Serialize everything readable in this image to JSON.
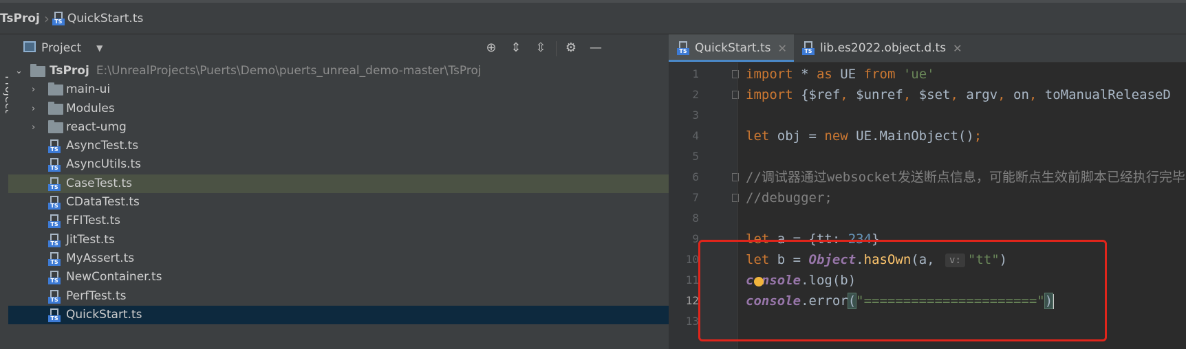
{
  "breadcrumb": {
    "project": "TsProj",
    "file": "QuickStart.ts"
  },
  "side_stripe": {
    "label": "Project"
  },
  "project_panel": {
    "title": "Project",
    "root": {
      "name": "TsProj",
      "path": "E:\\UnrealProjects\\Puerts\\Demo\\puerts_unreal_demo-master\\TsProj"
    },
    "folders": [
      "main-ui",
      "Modules",
      "react-umg"
    ],
    "files": [
      "AsyncTest.ts",
      "AsyncUtils.ts",
      "CaseTest.ts",
      "CDataTest.ts",
      "FFITest.ts",
      "JitTest.ts",
      "MyAssert.ts",
      "NewContainer.ts",
      "PerfTest.ts",
      "QuickStart.ts"
    ]
  },
  "editor": {
    "tabs": [
      {
        "label": "QuickStart.ts",
        "active": true
      },
      {
        "label": "lib.es2022.object.d.ts",
        "active": false
      }
    ],
    "line_numbers": [
      "1",
      "2",
      "3",
      "4",
      "5",
      "6",
      "7",
      "8",
      "9",
      "10",
      "11",
      "12",
      "13"
    ],
    "code": {
      "l1": {
        "kw1": "import",
        "t1": " * ",
        "kw2": "as",
        "t2": " UE ",
        "kw3": "from",
        "t3": " ",
        "str": "'ue'"
      },
      "l2": {
        "kw1": "import",
        "t1": " {$ref",
        "c1": ",",
        "t2": " $unref",
        "c2": ",",
        "t3": " $set",
        "c3": ",",
        "t4": " argv",
        "c4": ",",
        "t5": " on",
        "c5": ",",
        "t6": " toManualReleaseD"
      },
      "l4": {
        "kw1": "let",
        "t1": " obj = ",
        "kw2": "new",
        "t2": " UE.MainObject()",
        "semi": ";"
      },
      "l6": {
        "text": "//调试器通过websocket发送断点信息，可能断点生效前脚本已经执行完毕"
      },
      "l7": {
        "text": "//debugger;"
      },
      "l9": {
        "kw": "let",
        "t1": " a = {tt: ",
        "num": "234",
        "t2": "}"
      },
      "l10": {
        "kw": "let",
        "t1": " b = ",
        "obj": "Object",
        "t2": ".",
        "fn": "hasOwn",
        "t3": "(a, ",
        "hint": "v:",
        "str": "\"tt\"",
        "t4": ")"
      },
      "l11": {
        "obj": "console",
        "t1": ".log(b)"
      },
      "l12": {
        "obj": "console",
        "t1": ".error",
        "open": "(",
        "str": "\"======================\"",
        "close": ")"
      }
    }
  },
  "colors": {
    "annotation_box": "#e0251b",
    "tab_accent": "#4a88c7"
  }
}
